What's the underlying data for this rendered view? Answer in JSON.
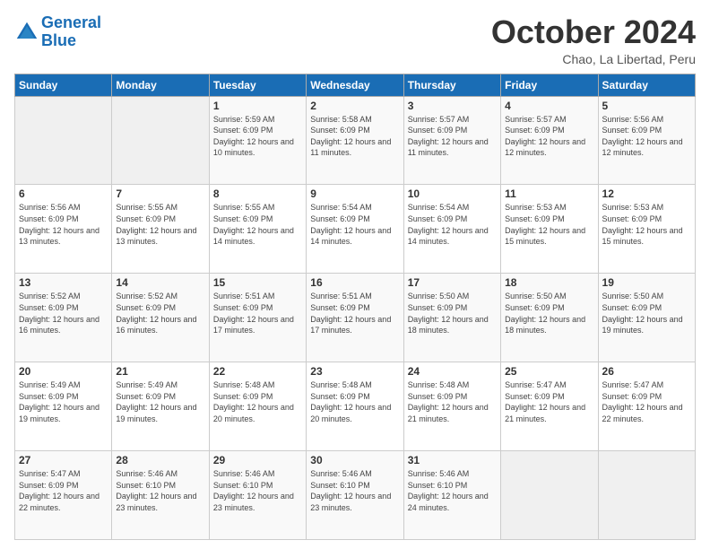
{
  "header": {
    "logo_line1": "General",
    "logo_line2": "Blue",
    "month": "October 2024",
    "location": "Chao, La Libertad, Peru"
  },
  "weekdays": [
    "Sunday",
    "Monday",
    "Tuesday",
    "Wednesday",
    "Thursday",
    "Friday",
    "Saturday"
  ],
  "weeks": [
    [
      {
        "day": "",
        "sunrise": "",
        "sunset": "",
        "daylight": ""
      },
      {
        "day": "",
        "sunrise": "",
        "sunset": "",
        "daylight": ""
      },
      {
        "day": "1",
        "sunrise": "Sunrise: 5:59 AM",
        "sunset": "Sunset: 6:09 PM",
        "daylight": "Daylight: 12 hours and 10 minutes."
      },
      {
        "day": "2",
        "sunrise": "Sunrise: 5:58 AM",
        "sunset": "Sunset: 6:09 PM",
        "daylight": "Daylight: 12 hours and 11 minutes."
      },
      {
        "day": "3",
        "sunrise": "Sunrise: 5:57 AM",
        "sunset": "Sunset: 6:09 PM",
        "daylight": "Daylight: 12 hours and 11 minutes."
      },
      {
        "day": "4",
        "sunrise": "Sunrise: 5:57 AM",
        "sunset": "Sunset: 6:09 PM",
        "daylight": "Daylight: 12 hours and 12 minutes."
      },
      {
        "day": "5",
        "sunrise": "Sunrise: 5:56 AM",
        "sunset": "Sunset: 6:09 PM",
        "daylight": "Daylight: 12 hours and 12 minutes."
      }
    ],
    [
      {
        "day": "6",
        "sunrise": "Sunrise: 5:56 AM",
        "sunset": "Sunset: 6:09 PM",
        "daylight": "Daylight: 12 hours and 13 minutes."
      },
      {
        "day": "7",
        "sunrise": "Sunrise: 5:55 AM",
        "sunset": "Sunset: 6:09 PM",
        "daylight": "Daylight: 12 hours and 13 minutes."
      },
      {
        "day": "8",
        "sunrise": "Sunrise: 5:55 AM",
        "sunset": "Sunset: 6:09 PM",
        "daylight": "Daylight: 12 hours and 14 minutes."
      },
      {
        "day": "9",
        "sunrise": "Sunrise: 5:54 AM",
        "sunset": "Sunset: 6:09 PM",
        "daylight": "Daylight: 12 hours and 14 minutes."
      },
      {
        "day": "10",
        "sunrise": "Sunrise: 5:54 AM",
        "sunset": "Sunset: 6:09 PM",
        "daylight": "Daylight: 12 hours and 14 minutes."
      },
      {
        "day": "11",
        "sunrise": "Sunrise: 5:53 AM",
        "sunset": "Sunset: 6:09 PM",
        "daylight": "Daylight: 12 hours and 15 minutes."
      },
      {
        "day": "12",
        "sunrise": "Sunrise: 5:53 AM",
        "sunset": "Sunset: 6:09 PM",
        "daylight": "Daylight: 12 hours and 15 minutes."
      }
    ],
    [
      {
        "day": "13",
        "sunrise": "Sunrise: 5:52 AM",
        "sunset": "Sunset: 6:09 PM",
        "daylight": "Daylight: 12 hours and 16 minutes."
      },
      {
        "day": "14",
        "sunrise": "Sunrise: 5:52 AM",
        "sunset": "Sunset: 6:09 PM",
        "daylight": "Daylight: 12 hours and 16 minutes."
      },
      {
        "day": "15",
        "sunrise": "Sunrise: 5:51 AM",
        "sunset": "Sunset: 6:09 PM",
        "daylight": "Daylight: 12 hours and 17 minutes."
      },
      {
        "day": "16",
        "sunrise": "Sunrise: 5:51 AM",
        "sunset": "Sunset: 6:09 PM",
        "daylight": "Daylight: 12 hours and 17 minutes."
      },
      {
        "day": "17",
        "sunrise": "Sunrise: 5:50 AM",
        "sunset": "Sunset: 6:09 PM",
        "daylight": "Daylight: 12 hours and 18 minutes."
      },
      {
        "day": "18",
        "sunrise": "Sunrise: 5:50 AM",
        "sunset": "Sunset: 6:09 PM",
        "daylight": "Daylight: 12 hours and 18 minutes."
      },
      {
        "day": "19",
        "sunrise": "Sunrise: 5:50 AM",
        "sunset": "Sunset: 6:09 PM",
        "daylight": "Daylight: 12 hours and 19 minutes."
      }
    ],
    [
      {
        "day": "20",
        "sunrise": "Sunrise: 5:49 AM",
        "sunset": "Sunset: 6:09 PM",
        "daylight": "Daylight: 12 hours and 19 minutes."
      },
      {
        "day": "21",
        "sunrise": "Sunrise: 5:49 AM",
        "sunset": "Sunset: 6:09 PM",
        "daylight": "Daylight: 12 hours and 19 minutes."
      },
      {
        "day": "22",
        "sunrise": "Sunrise: 5:48 AM",
        "sunset": "Sunset: 6:09 PM",
        "daylight": "Daylight: 12 hours and 20 minutes."
      },
      {
        "day": "23",
        "sunrise": "Sunrise: 5:48 AM",
        "sunset": "Sunset: 6:09 PM",
        "daylight": "Daylight: 12 hours and 20 minutes."
      },
      {
        "day": "24",
        "sunrise": "Sunrise: 5:48 AM",
        "sunset": "Sunset: 6:09 PM",
        "daylight": "Daylight: 12 hours and 21 minutes."
      },
      {
        "day": "25",
        "sunrise": "Sunrise: 5:47 AM",
        "sunset": "Sunset: 6:09 PM",
        "daylight": "Daylight: 12 hours and 21 minutes."
      },
      {
        "day": "26",
        "sunrise": "Sunrise: 5:47 AM",
        "sunset": "Sunset: 6:09 PM",
        "daylight": "Daylight: 12 hours and 22 minutes."
      }
    ],
    [
      {
        "day": "27",
        "sunrise": "Sunrise: 5:47 AM",
        "sunset": "Sunset: 6:09 PM",
        "daylight": "Daylight: 12 hours and 22 minutes."
      },
      {
        "day": "28",
        "sunrise": "Sunrise: 5:46 AM",
        "sunset": "Sunset: 6:10 PM",
        "daylight": "Daylight: 12 hours and 23 minutes."
      },
      {
        "day": "29",
        "sunrise": "Sunrise: 5:46 AM",
        "sunset": "Sunset: 6:10 PM",
        "daylight": "Daylight: 12 hours and 23 minutes."
      },
      {
        "day": "30",
        "sunrise": "Sunrise: 5:46 AM",
        "sunset": "Sunset: 6:10 PM",
        "daylight": "Daylight: 12 hours and 23 minutes."
      },
      {
        "day": "31",
        "sunrise": "Sunrise: 5:46 AM",
        "sunset": "Sunset: 6:10 PM",
        "daylight": "Daylight: 12 hours and 24 minutes."
      },
      {
        "day": "",
        "sunrise": "",
        "sunset": "",
        "daylight": ""
      },
      {
        "day": "",
        "sunrise": "",
        "sunset": "",
        "daylight": ""
      }
    ]
  ]
}
